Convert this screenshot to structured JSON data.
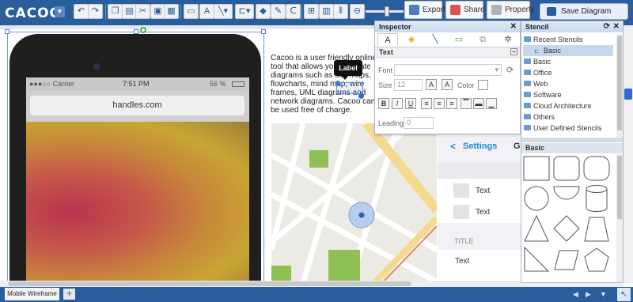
{
  "app": {
    "logo": "CACOO"
  },
  "toolbar": {
    "export_label": "Export",
    "share_label": "Share",
    "property_label": "Property",
    "save_label": "Save Diagram",
    "accent_color": "#2a5d9c"
  },
  "canvas": {
    "phone": {
      "carrier": "●●●○○ Carrier",
      "time": "7:51 PM",
      "battery": "56 %",
      "url": "handles.com"
    },
    "text_block": "Cacoo is a user friendly online tool that allows you to create diagrams such as site maps, flowcharts, mind map, wire frames, UML diagrams and network diagrams. Cacoo can be used free of charge.",
    "label_popup": "Label",
    "settings_panel": {
      "back": "Settings",
      "items": [
        "Text",
        "Text"
      ],
      "section_title": "TITLE",
      "last_item": "Text",
      "extra_char": "G"
    }
  },
  "inspector": {
    "title": "Inspector",
    "section": "Text",
    "font_label": "Font",
    "size_label": "Size",
    "size_value": "12",
    "color_label": "Color",
    "leading_label": "Leading",
    "leading_value": "0"
  },
  "stencil": {
    "title": "Stencil",
    "tree": [
      {
        "label": "Recent Stencils",
        "indent": false
      },
      {
        "label": "Basic",
        "indent": true
      },
      {
        "label": "Basic",
        "indent": false
      },
      {
        "label": "Office",
        "indent": false
      },
      {
        "label": "Web",
        "indent": false
      },
      {
        "label": "Software",
        "indent": false
      },
      {
        "label": "Cloud Architecture",
        "indent": false
      },
      {
        "label": "Others",
        "indent": false
      },
      {
        "label": "User Defined Stencils",
        "indent": false
      }
    ],
    "basic_header": "Basic"
  },
  "bottombar": {
    "tab_label": "Mobile Wireframe",
    "add_label": "+"
  }
}
